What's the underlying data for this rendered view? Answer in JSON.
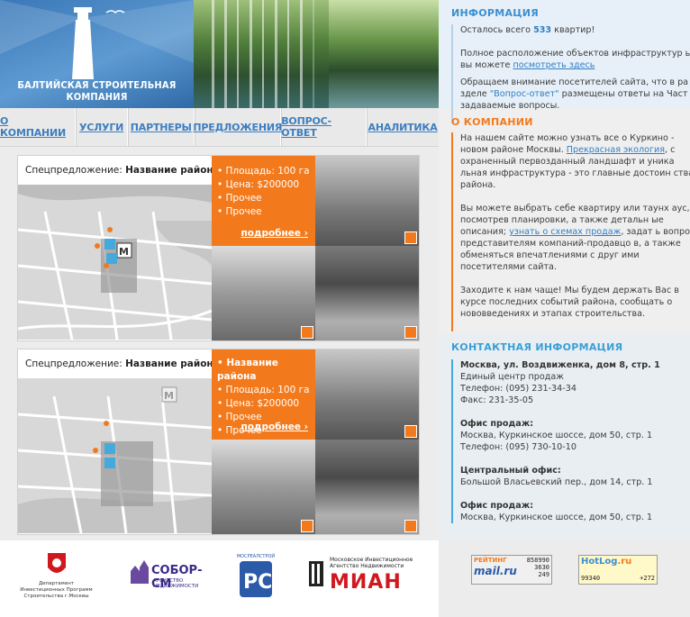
{
  "header": {
    "company_name_line1": "БАЛТИЙСКАЯ СТРОИТЕЛЬНАЯ",
    "company_name_line2": "КОМПАНИЯ"
  },
  "nav": {
    "items": [
      {
        "label": "О КОМПАНИИ"
      },
      {
        "label": "УСЛУГИ"
      },
      {
        "label": "ПАРТНЕРЫ"
      },
      {
        "label": "ПРЕДЛОЖЕНИЯ"
      },
      {
        "label": "ВОПРОС-ОТВЕТ"
      },
      {
        "label": "АНАЛИТИКА"
      }
    ]
  },
  "offers": [
    {
      "prefix": "Спецпредложение: ",
      "title": "Название района",
      "bullets": [
        "Площадь: 100 га",
        "Цена: $200000",
        "Прочее",
        "Прочее"
      ],
      "more": "подробнее"
    },
    {
      "prefix": "Спецпредложение: ",
      "title": "Название района",
      "bullets": [
        "Название района",
        "Площадь: 100 га",
        "Цена: $200000",
        "Прочее",
        "Прочее"
      ],
      "more": "подробнее"
    }
  ],
  "info": {
    "heading": "ИНФОРМАЦИЯ",
    "p1_a": "Осталось всего ",
    "p1_num": "533",
    "p1_b": " квартир!",
    "p2_a": "Полное расположение объектов инфраструктур ы вы можете ",
    "p2_link": "посмотреть здесь",
    "p3_a": "Обращаем внимание посетителей сайта, что в ра зделе ",
    "p3_hl": "\"Вопрос-ответ\"",
    "p3_b": " размещены ответы на Част о задаваемые вопросы."
  },
  "about": {
    "heading": "О КОМПАНИИ",
    "p1_a": "На нашем сайте можно узнать все о Куркино - новом районе Москвы. ",
    "p1_link": "Прекрасная экология",
    "p1_b": ", с охраненный первозданный ландшафт и уника льная инфраструктура - это главные достоин ства района.",
    "p2_a": "Вы можете выбрать себе квартиру или таунх аус, посмотрев планировки, а также детальн ые описания; ",
    "p2_link": "узнать о схемах продаж",
    "p2_b": ", задат ь вопрос представителям компаний-продавцо в, а также обменяться впечатлениями с друг ими посетителями сайта.",
    "p3": "Заходите к нам чаще! Мы будем держать Вас в курсе последних событий района, сообщать о нововведениях и этапах строительства."
  },
  "contacts": {
    "heading": "КОНТАКТНАЯ ИНФОРМАЦИЯ",
    "blocks": [
      {
        "title": "Москва, ул. Воздвиженка, дом 8, стр. 1",
        "lines": [
          "Единый центр продаж",
          "Телефон: (095) 231-34-34",
          "Факс: 231-35-05"
        ]
      },
      {
        "title": "Офис продаж:",
        "lines": [
          "Москва, Куркинское шоссе, дом 50, стр. 1",
          "Телефон: (095) 730-10-10"
        ]
      },
      {
        "title": "Центральный офис:",
        "lines": [
          "Большой Власьевский пер., дом 14, стр. 1"
        ]
      },
      {
        "title": "Офис продаж:",
        "lines": [
          "Москва, Куркинское шоссе, дом 50, стр. 1"
        ]
      }
    ]
  },
  "footer": {
    "logo1_caption": "Департамент Инвестиционных Программ Строительства г.Москвы",
    "logo2_name": "СОБОР-СМ",
    "logo2_caption": "АГЕНТСТВО НЕДВИЖИМОСТИ",
    "logo3_caption": "МОСРЕАЛСТРОЙ",
    "logo4_caption_top": "Московское Инвестиционное Агентство Недвижимости",
    "logo4_name": "МИАН",
    "rating_label": "РЕЙТИНГ",
    "rating_brand": "mail.ru",
    "rating_v1": "858990",
    "rating_v2": "3630",
    "rating_v3": "249",
    "hotlog_brand": "HotLog",
    "hotlog_ru": ".ru",
    "hotlog_v1": "99340",
    "hotlog_v2": "+272"
  },
  "colors": {
    "accent_orange": "#f37a1c",
    "accent_blue": "#2f7fc6",
    "heading_blue": "#3a8fd0"
  }
}
